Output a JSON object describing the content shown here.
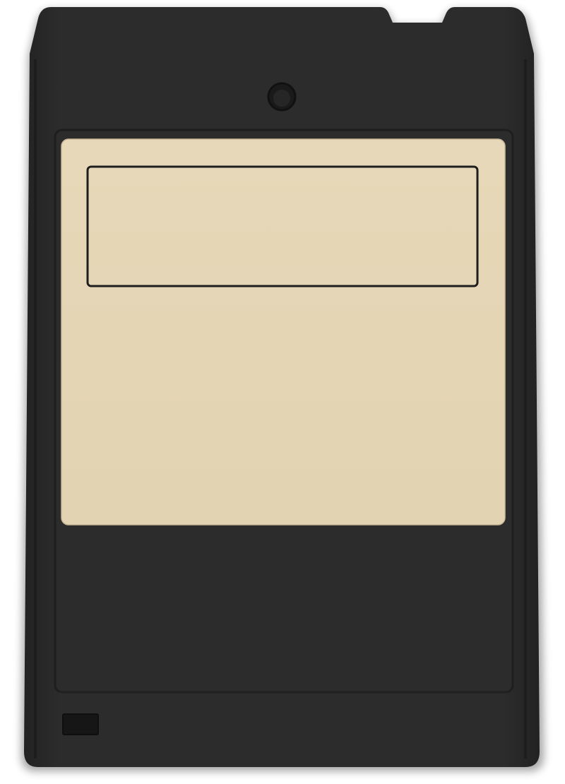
{
  "object": {
    "kind": "8-track tape cartridge",
    "view": "front",
    "colors": {
      "shell": "#2b2b2b",
      "shell_edge": "#1f1f1f",
      "inner_panel": "#2e2e2e",
      "label": "#e4d6b6",
      "label_border": "#cbb998",
      "title_box_stroke": "#1e1e1e",
      "background": "#ffffff"
    }
  },
  "label": {
    "title_text": "",
    "body_text": ""
  },
  "icons": {
    "hole": "circle-hole",
    "slot": "rectangular-slot"
  }
}
